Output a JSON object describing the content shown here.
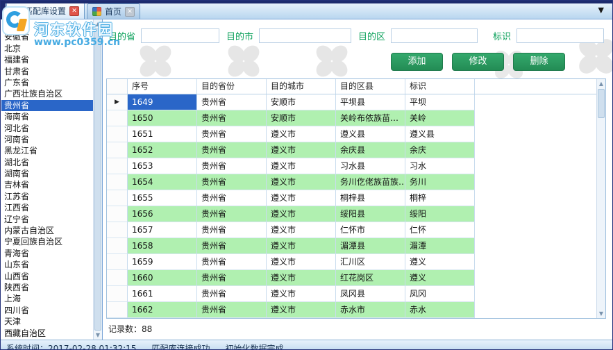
{
  "tab_bar": {
    "dropdown_glyph": "▼",
    "tabs": [
      {
        "label": "匹配库设置",
        "close_glyph": "✕"
      },
      {
        "label": "首页",
        "close_glyph": "✕"
      }
    ]
  },
  "watermark": {
    "site_name": "河东软件园",
    "site_url": "www.pc0359.cn"
  },
  "sidebar": {
    "selected": "贵州省",
    "items": [
      "",
      "安徽省",
      "北京",
      "福建省",
      "甘肃省",
      "广东省",
      "广西壮族自治区",
      "贵州省",
      "海南省",
      "河北省",
      "河南省",
      "黑龙江省",
      "湖北省",
      "湖南省",
      "吉林省",
      "江苏省",
      "江西省",
      "辽宁省",
      "内蒙古自治区",
      "宁夏回族自治区",
      "青海省",
      "山东省",
      "山西省",
      "陕西省",
      "上海",
      "四川省",
      "天津",
      "西藏自治区"
    ]
  },
  "form": {
    "fields": [
      {
        "label": "目的省",
        "value": ""
      },
      {
        "label": "目的市",
        "value": ""
      },
      {
        "label": "目的区",
        "value": ""
      },
      {
        "label": "标识",
        "value": ""
      }
    ],
    "buttons": [
      "添加",
      "修改",
      "删除"
    ]
  },
  "table": {
    "columns": [
      "序号",
      "目的省份",
      "目的城市",
      "目的区县",
      "标识"
    ],
    "selected_row_index": 0,
    "rows": [
      [
        "1649",
        "贵州省",
        "安顺市",
        "平坝县",
        "平坝"
      ],
      [
        "1650",
        "贵州省",
        "安顺市",
        "关岭布依族苗…",
        "关岭"
      ],
      [
        "1651",
        "贵州省",
        "遵义市",
        "遵义县",
        "遵义县"
      ],
      [
        "1652",
        "贵州省",
        "遵义市",
        "余庆县",
        "余庆"
      ],
      [
        "1653",
        "贵州省",
        "遵义市",
        "习水县",
        "习水"
      ],
      [
        "1654",
        "贵州省",
        "遵义市",
        "务川仡佬族苗族…",
        "务川"
      ],
      [
        "1655",
        "贵州省",
        "遵义市",
        "桐梓县",
        "桐梓"
      ],
      [
        "1656",
        "贵州省",
        "遵义市",
        "绥阳县",
        "绥阳"
      ],
      [
        "1657",
        "贵州省",
        "遵义市",
        "仁怀市",
        "仁怀"
      ],
      [
        "1658",
        "贵州省",
        "遵义市",
        "湄潭县",
        "湄潭"
      ],
      [
        "1659",
        "贵州省",
        "遵义市",
        "汇川区",
        "遵义"
      ],
      [
        "1660",
        "贵州省",
        "遵义市",
        "红花岗区",
        "遵义"
      ],
      [
        "1661",
        "贵州省",
        "遵义市",
        "凤冈县",
        "凤冈"
      ],
      [
        "1662",
        "贵州省",
        "遵义市",
        "赤水市",
        "赤水"
      ]
    ]
  },
  "record_count": "记录数：88",
  "status_bar": {
    "items": [
      "系统时间：2017-02-28 01:32:15",
      "匹配库连接成功",
      "初始化数据完成"
    ]
  },
  "glyphs": {
    "scroll_up": "▲",
    "scroll_down": "▼",
    "row_indicator": "▶"
  },
  "colors": {
    "selection_blue": "#2a66c8",
    "row_green": "#b0f0b0",
    "button_green": "#2a9d63",
    "label_green": "#0aa05a",
    "tab_close_red": "#e0544a",
    "titlebar_blue": "#1d2b6e"
  }
}
